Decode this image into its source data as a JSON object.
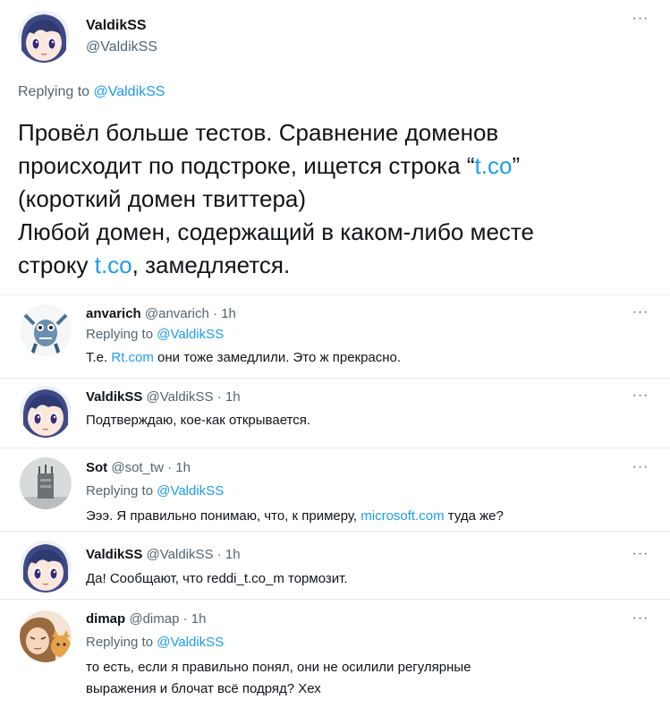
{
  "main": {
    "name": "ValdikSS",
    "handle": "@ValdikSS",
    "replying_prefix": "Replying to ",
    "replying_to": "@ValdikSS",
    "text_line1": "Провёл больше тестов. Сравнение доменов",
    "text_line2_pre": "происходит по подстроке, ищется строка “",
    "text_line2_link": "t.co",
    "text_line2_post": "”",
    "text_line3": "(короткий домен твиттера)",
    "text_line4": "Любой домен, содержащий в каком-либо месте",
    "text_line5_pre": "строку ",
    "text_line5_link": "t.co",
    "text_line5_post": ", замедляется.",
    "more": "···"
  },
  "replies": [
    {
      "name": "anvarich",
      "handle": "@anvarich · 1h",
      "replying_prefix": "Replying to ",
      "replying_to": "@ValdikSS",
      "text_pre": "Т.е. ",
      "text_link": "Rt.com",
      "text_post": " они тоже замедлили. Это ж прекрасно.",
      "more": "···"
    },
    {
      "name": "ValdikSS",
      "handle": "@ValdikSS · 1h",
      "text": "Подтверждаю, кое-как открывается.",
      "more": "···"
    },
    {
      "name": "Sot",
      "handle": "@sot_tw · 1h",
      "replying_prefix": "Replying to ",
      "replying_to": "@ValdikSS",
      "text_pre": "Эээ. Я правильно понимаю, что, к примеру, ",
      "text_link": "microsoft.com",
      "text_post": " туда же?",
      "more": "···"
    },
    {
      "name": "ValdikSS",
      "handle": "@ValdikSS · 1h",
      "text": "Да! Сообщают, что reddi_t.co_m тормозит.",
      "more": "···"
    },
    {
      "name": "dimap",
      "handle": "@dimap · 1h",
      "replying_prefix": "Replying to ",
      "replying_to": "@ValdikSS",
      "text_line1": "то есть, если я правильно понял, они не осилили регулярные",
      "text_line2": "выражения и блочат всё подряд? Хех",
      "more": "···"
    }
  ]
}
